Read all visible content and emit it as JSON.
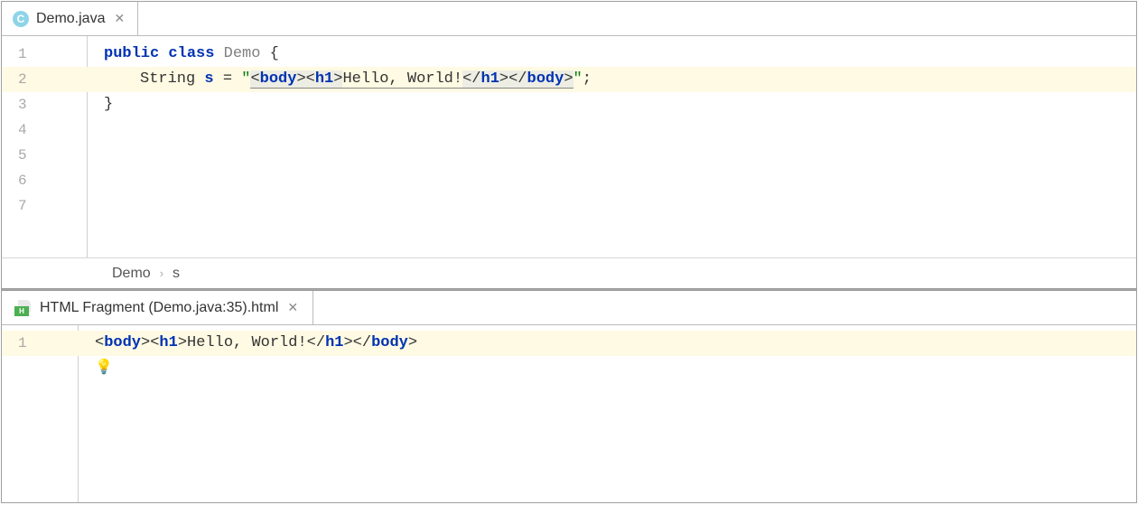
{
  "topEditor": {
    "tab": {
      "icon_letter": "C",
      "filename": "Demo.java"
    },
    "gutter": [
      "1",
      "2",
      "3",
      "4",
      "5",
      "6",
      "7"
    ],
    "highlightedLine": 2,
    "code": {
      "line1": {
        "kw1": "public",
        "sp1": " ",
        "kw2": "class",
        "sp2": " ",
        "cls": "Demo",
        "sp3": " ",
        "brace": "{"
      },
      "line2": {
        "type": "String",
        "sp1": " ",
        "var": "s",
        "sp2": " ",
        "eq": "=",
        "sp3": " ",
        "q1": "\"",
        "lt1": "<",
        "tag_body1": "body",
        "gt1": ">",
        "lt2": "<",
        "tag_h1a": "h1",
        "gt2": ">",
        "text": "Hello, World!",
        "lt3": "</",
        "tag_h1b": "h1",
        "gt3": ">",
        "lt4": "</",
        "tag_body2": "body",
        "gt4": ">",
        "q2": "\"",
        "semi": ";"
      },
      "line3": {
        "brace": "}"
      }
    },
    "breadcrumb": {
      "item1": "Demo",
      "item2": "s"
    }
  },
  "bottomEditor": {
    "tab": {
      "icon_badge": "H",
      "filename": "HTML Fragment (Demo.java:35).html"
    },
    "gutter": [
      "1"
    ],
    "highlightedLine": 1,
    "code": {
      "line1": {
        "lt1": "<",
        "tag_body1": "body",
        "gt1": ">",
        "lt2": "<",
        "tag_h1a": "h1",
        "gt2": ">",
        "text": "Hello, World!",
        "lt3": "</",
        "tag_h1b": "h1",
        "gt3": ">",
        "lt4": "</",
        "tag_body2": "body",
        "gt4": ">"
      }
    },
    "bulb": "💡"
  }
}
